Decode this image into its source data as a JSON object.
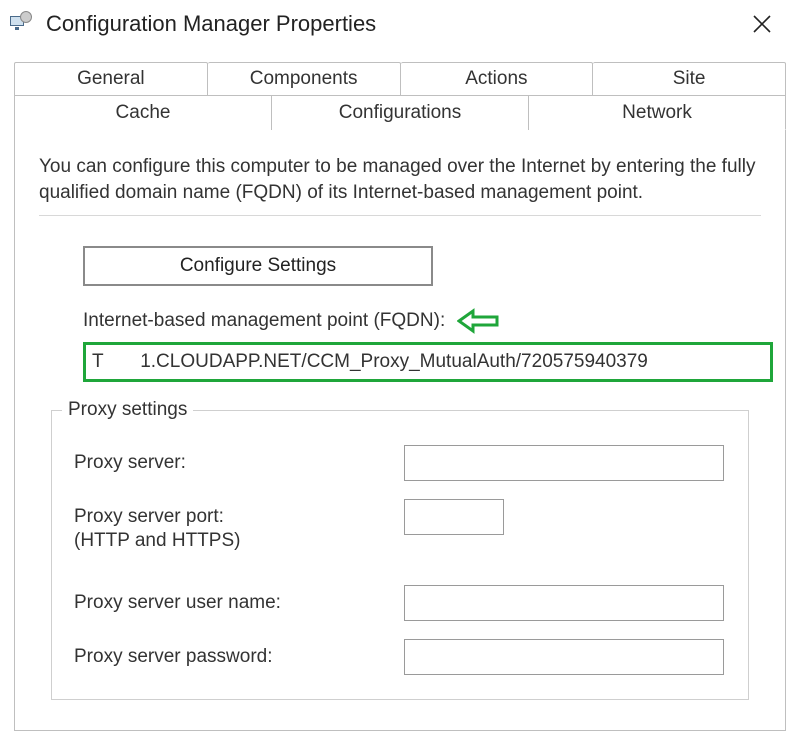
{
  "annotation_color": "#1fa63a",
  "titlebar": {
    "title": "Configuration Manager Properties"
  },
  "tabs_row1": [
    {
      "label": "General"
    },
    {
      "label": "Components"
    },
    {
      "label": "Actions"
    },
    {
      "label": "Site"
    }
  ],
  "tabs_row2": [
    {
      "label": "Cache"
    },
    {
      "label": "Configurations"
    },
    {
      "label": "Network",
      "active": true
    }
  ],
  "panel": {
    "description": "You can configure this computer to be managed over the Internet by entering the fully qualified domain name (FQDN) of its Internet-based management point.",
    "configure_button": "Configure Settings",
    "fqdn_label": "Internet-based management point (FQDN):",
    "fqdn_value": "T       1.CLOUDAPP.NET/CCM_Proxy_MutualAuth/720575940379"
  },
  "proxy_section": {
    "legend": "Proxy settings",
    "server_label": "Proxy server:",
    "server_value": "",
    "port_label_line1": "Proxy server port:",
    "port_label_line2": "(HTTP and HTTPS)",
    "port_value": "",
    "user_label": "Proxy server user name:",
    "user_value": "",
    "password_label": "Proxy server password:",
    "password_value": ""
  }
}
